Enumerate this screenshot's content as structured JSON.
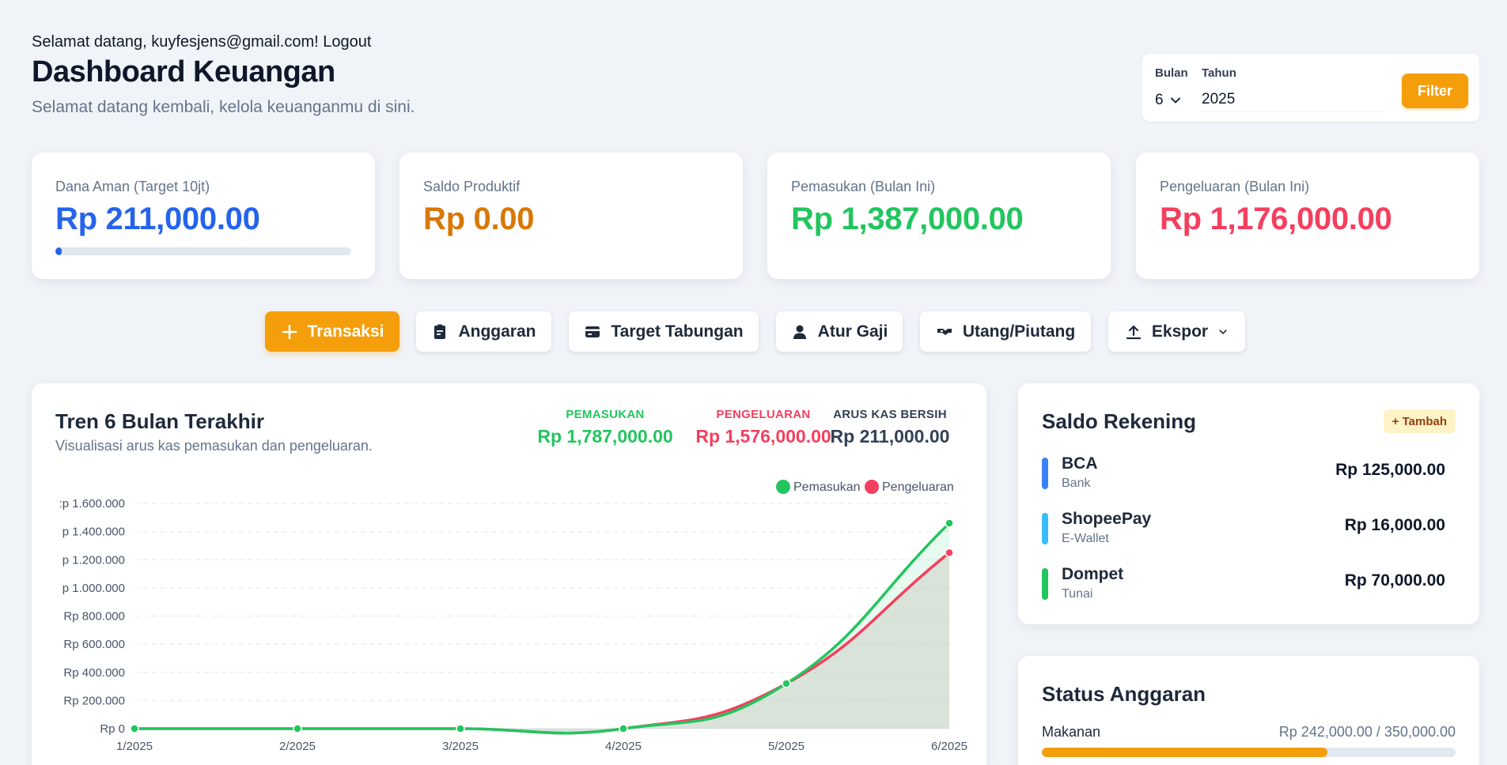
{
  "header": {
    "welcome": "Selamat datang, kuyfesjens@gmail.com! Logout",
    "title": "Dashboard Keuangan",
    "subtitle": "Selamat datang kembali, kelola keuanganmu di sini."
  },
  "filter": {
    "month_label": "Bulan",
    "month_value": "6",
    "year_label": "Tahun",
    "year_value": "2025",
    "button_label": "Filter"
  },
  "stats": [
    {
      "label": "Dana Aman (Target 10jt)",
      "value": "Rp 211,000.00",
      "color": "#2563eb",
      "progress": 0.021
    },
    {
      "label": "Saldo Produktif",
      "value": "Rp 0.00",
      "color": "#d97706"
    },
    {
      "label": "Pemasukan (Bulan Ini)",
      "value": "Rp 1,387,000.00",
      "color": "#22c55e"
    },
    {
      "label": "Pengeluaran (Bulan Ini)",
      "value": "Rp 1,176,000.00",
      "color": "#f43f5e"
    }
  ],
  "actions": [
    {
      "label": "Transaksi",
      "icon": "plus-icon"
    },
    {
      "label": "Anggaran",
      "icon": "clipboard-icon"
    },
    {
      "label": "Target Tabungan",
      "icon": "credit-card-icon"
    },
    {
      "label": "Atur Gaji",
      "icon": "user-icon"
    },
    {
      "label": "Utang/Piutang",
      "icon": "handshake-icon"
    },
    {
      "label": "Ekspor",
      "icon": "upload-icon"
    }
  ],
  "trend": {
    "title": "Tren 6 Bulan Terakhir",
    "subtitle": "Visualisasi arus kas pemasukan dan pengeluaran.",
    "summary": [
      {
        "label": "PEMASUKAN",
        "value": "Rp 1,787,000.00",
        "color": "#22c55e"
      },
      {
        "label": "PENGELUARAN",
        "value": "Rp 1,576,000.00",
        "color": "#f43f5e"
      },
      {
        "label": "ARUS KAS BERSIH",
        "value": "Rp 211,000.00",
        "color": "#334155"
      }
    ]
  },
  "chart_data": {
    "type": "line",
    "x": [
      "1/2025",
      "2/2025",
      "3/2025",
      "4/2025",
      "5/2025",
      "6/2025"
    ],
    "ylim": [
      0,
      1600000
    ],
    "yticks": [
      {
        "value": 0,
        "label": "Rp 0"
      },
      {
        "value": 200000,
        "label": "Rp 200.000"
      },
      {
        "value": 400000,
        "label": "Rp 400.000"
      },
      {
        "value": 600000,
        "label": "Rp 600.000"
      },
      {
        "value": 800000,
        "label": "Rp 800.000"
      },
      {
        "value": 1000000,
        "label": "p 1.000.000"
      },
      {
        "value": 1200000,
        "label": "p 1.200.000"
      },
      {
        "value": 1400000,
        "label": "p 1.400.000"
      },
      {
        "value": 1600000,
        "label": ":p 1.600.000"
      }
    ],
    "series": [
      {
        "name": "Pemasukan",
        "color": "#22c55e",
        "values": [
          0,
          0,
          0,
          0,
          320000,
          1460000
        ]
      },
      {
        "name": "Pengeluaran",
        "color": "#f43f5e",
        "values": [
          0,
          0,
          0,
          0,
          320000,
          1250000
        ]
      }
    ],
    "legend": "top-right",
    "grid": true
  },
  "accounts": {
    "title": "Saldo Rekening",
    "add_label": "+ Tambah",
    "items": [
      {
        "name": "BCA",
        "type": "Bank",
        "amount": "Rp 125,000.00",
        "color": "#3b82f6"
      },
      {
        "name": "ShopeePay",
        "type": "E-Wallet",
        "amount": "Rp 16,000.00",
        "color": "#38bdf8"
      },
      {
        "name": "Dompet",
        "type": "Tunai",
        "amount": "Rp 70,000.00",
        "color": "#22c55e"
      }
    ]
  },
  "budget": {
    "title": "Status Anggaran",
    "items": [
      {
        "name": "Makanan",
        "amount": "Rp 242,000.00 / 350,000.00",
        "progress": 0.69
      }
    ]
  }
}
